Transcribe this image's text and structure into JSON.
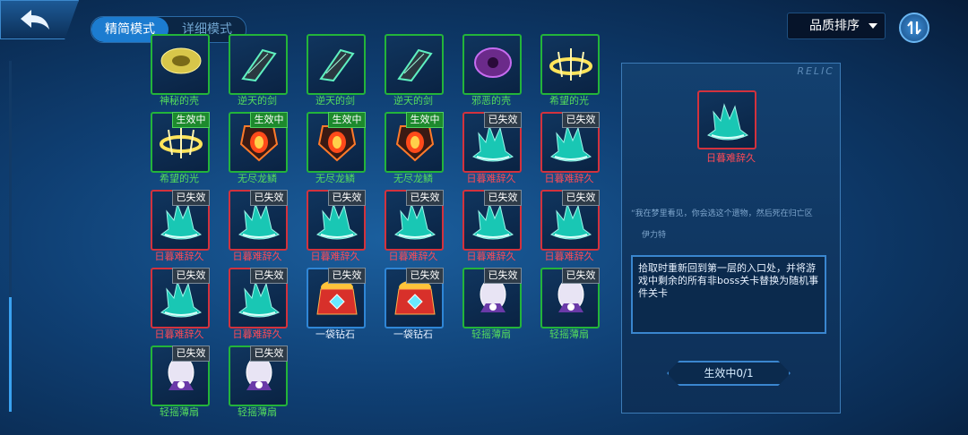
{
  "header": {
    "tabs": [
      {
        "label": "精简模式",
        "active": true
      },
      {
        "label": "详细模式",
        "active": false
      }
    ],
    "sort_label": "品质排序"
  },
  "relics": [
    {
      "name": "神秘的壳",
      "frame": "green",
      "badge": "",
      "icon": "shell-icon"
    },
    {
      "name": "逆天的剑",
      "frame": "green",
      "badge": "",
      "icon": "sword-icon"
    },
    {
      "name": "逆天的剑",
      "frame": "green",
      "badge": "",
      "icon": "sword-icon"
    },
    {
      "name": "逆天的剑",
      "frame": "green",
      "badge": "",
      "icon": "sword-icon"
    },
    {
      "name": "邪恶的壳",
      "frame": "green",
      "badge": "",
      "icon": "evil-shell-icon"
    },
    {
      "name": "希望的光",
      "frame": "green",
      "badge": "",
      "icon": "halo-icon"
    },
    {
      "name": "希望的光",
      "frame": "green",
      "badge": "生效中",
      "icon": "halo-icon"
    },
    {
      "name": "无尽龙鳞",
      "frame": "green",
      "badge": "生效中",
      "icon": "dragon-scale-icon"
    },
    {
      "name": "无尽龙鳞",
      "frame": "green",
      "badge": "生效中",
      "icon": "dragon-scale-icon"
    },
    {
      "name": "无尽龙鳞",
      "frame": "green",
      "badge": "生效中",
      "icon": "dragon-scale-icon"
    },
    {
      "name": "日暮难辞久",
      "frame": "red",
      "badge": "已失效",
      "icon": "witch-hat-icon"
    },
    {
      "name": "日暮难辞久",
      "frame": "red",
      "badge": "已失效",
      "icon": "witch-hat-icon"
    },
    {
      "name": "日暮难辞久",
      "frame": "red",
      "badge": "已失效",
      "icon": "witch-hat-icon"
    },
    {
      "name": "日暮难辞久",
      "frame": "red",
      "badge": "已失效",
      "icon": "witch-hat-icon"
    },
    {
      "name": "日暮难辞久",
      "frame": "red",
      "badge": "已失效",
      "icon": "witch-hat-icon"
    },
    {
      "name": "日暮难辞久",
      "frame": "red",
      "badge": "已失效",
      "icon": "witch-hat-icon"
    },
    {
      "name": "日暮难辞久",
      "frame": "red",
      "badge": "已失效",
      "icon": "witch-hat-icon"
    },
    {
      "name": "日暮难辞久",
      "frame": "red",
      "badge": "已失效",
      "icon": "witch-hat-icon"
    },
    {
      "name": "日暮难辞久",
      "frame": "red",
      "badge": "已失效",
      "icon": "witch-hat-icon"
    },
    {
      "name": "日暮难辞久",
      "frame": "red",
      "badge": "已失效",
      "icon": "witch-hat-icon"
    },
    {
      "name": "一袋钻石",
      "frame": "blue",
      "badge": "已失效",
      "icon": "diamond-bag-icon"
    },
    {
      "name": "一袋钻石",
      "frame": "blue",
      "badge": "已失效",
      "icon": "diamond-bag-icon"
    },
    {
      "name": "轻摇薄扇",
      "frame": "green",
      "badge": "已失效",
      "icon": "fan-icon"
    },
    {
      "name": "轻摇薄扇",
      "frame": "green",
      "badge": "已失效",
      "icon": "fan-icon"
    },
    {
      "name": "轻摇薄扇",
      "frame": "green",
      "badge": "已失效",
      "icon": "fan-icon"
    },
    {
      "name": "轻摇薄扇",
      "frame": "green",
      "badge": "已失效",
      "icon": "fan-icon"
    }
  ],
  "detail": {
    "relic_tag": "RELIC",
    "selected_name": "日暮难辞久",
    "flavor": "“我在梦里看见，你会选这个遗物，然后死在归亡区",
    "author": "伊力特",
    "description": "拾取时重新回到第一层的入口处，并将游戏中剩余的所有非boss关卡替换为随机事件关卡",
    "status": "生效中0/1"
  },
  "colors": {
    "frame_green": "#23b43a",
    "frame_red": "#d3323d",
    "frame_blue": "#2f86d6",
    "accent": "#1c7cd0"
  }
}
